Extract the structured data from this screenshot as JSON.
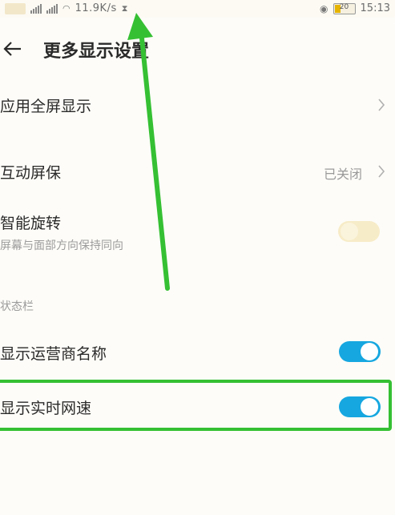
{
  "status_bar": {
    "network_speed": "11.9K/s",
    "battery_level": "20",
    "time": "15:13"
  },
  "header": {
    "title": "更多显示设置"
  },
  "settings": {
    "fullscreen_apps": {
      "label": "应用全屏显示"
    },
    "interactive_screensaver": {
      "label": "互动屏保",
      "value": "已关闭"
    },
    "smart_rotation": {
      "label": "智能旋转",
      "sublabel": "屏幕与面部方向保持同向",
      "enabled": false
    },
    "status_bar_section": {
      "label": "状态栏"
    },
    "show_carrier_name": {
      "label": "显示运营商名称",
      "enabled": true
    },
    "show_network_speed": {
      "label": "显示实时网速",
      "enabled": true
    }
  },
  "colors": {
    "toggle_on": "#16a7e0",
    "annotation": "#35c033",
    "background": "#fdfcf8"
  }
}
